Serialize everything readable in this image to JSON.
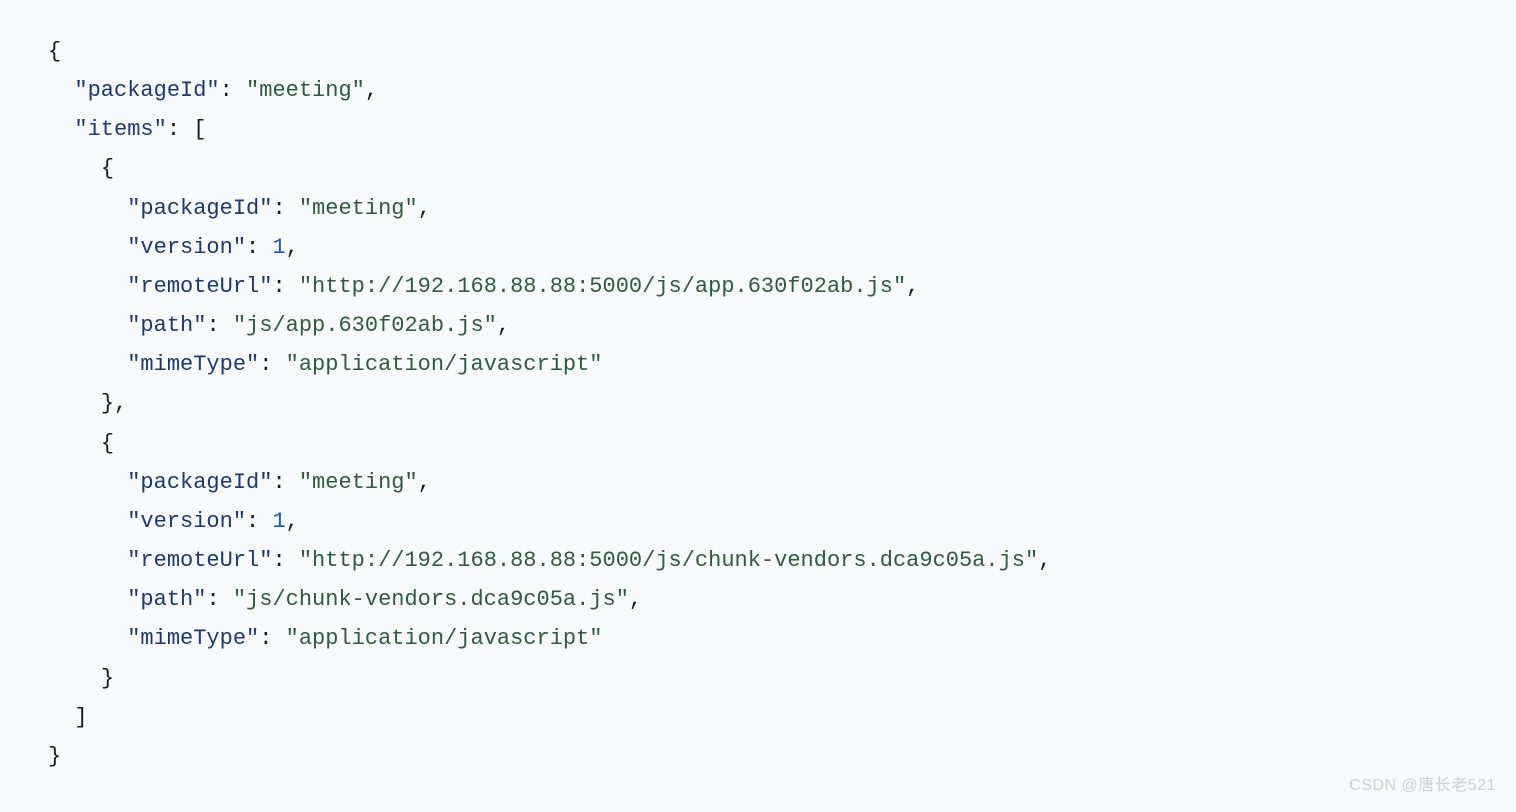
{
  "code": {
    "line1_brace": "{",
    "line2_key": "\"packageId\"",
    "line2_colon": ": ",
    "line2_val": "\"meeting\"",
    "line2_comma": ",",
    "line3_key": "\"items\"",
    "line3_colon": ": [",
    "line4_brace": "{",
    "item1_k1": "\"packageId\"",
    "item1_v1": "\"meeting\"",
    "item1_k2": "\"version\"",
    "item1_v2": "1",
    "item1_k3": "\"remoteUrl\"",
    "item1_v3": "\"http://192.168.88.88:5000/js/app.630f02ab.js\"",
    "item1_k4": "\"path\"",
    "item1_v4": "\"js/app.630f02ab.js\"",
    "item1_k5": "\"mimeType\"",
    "item1_v5": "\"application/javascript\"",
    "line10_brace": "},",
    "line11_brace": "{",
    "item2_k1": "\"packageId\"",
    "item2_v1": "\"meeting\"",
    "item2_k2": "\"version\"",
    "item2_v2": "1",
    "item2_k3": "\"remoteUrl\"",
    "item2_v3": "\"http://192.168.88.88:5000/js/chunk-vendors.dca9c05a.js\"",
    "item2_k4": "\"path\"",
    "item2_v4": "\"js/chunk-vendors.dca9c05a.js\"",
    "item2_k5": "\"mimeType\"",
    "item2_v5": "\"application/javascript\"",
    "line17_brace": "}",
    "line18_bracket": "]",
    "line19_brace": "}",
    "colon_space": ": ",
    "comma": ","
  },
  "watermark": "CSDN @唐长老521"
}
